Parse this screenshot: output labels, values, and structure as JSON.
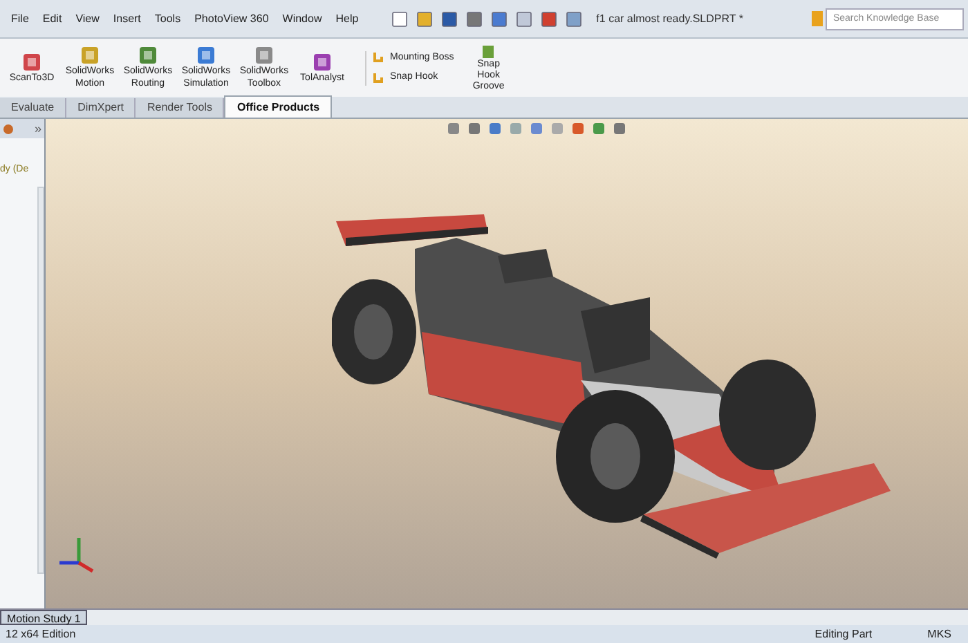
{
  "menu": [
    "File",
    "Edit",
    "View",
    "Insert",
    "Tools",
    "PhotoView 360",
    "Window",
    "Help"
  ],
  "document_title": "f1 car almost ready.SLDPRT *",
  "search": {
    "placeholder": "Search Knowledge Base"
  },
  "ribbon_tools": [
    {
      "label": "ScanTo3D",
      "kind": "scan"
    },
    {
      "label": "SolidWorks Motion",
      "kind": "motion"
    },
    {
      "label": "SolidWorks Routing",
      "kind": "routing"
    },
    {
      "label": "SolidWorks Simulation",
      "kind": "simulation"
    },
    {
      "label": "SolidWorks Toolbox",
      "kind": "toolbox"
    },
    {
      "label": "TolAnalyst",
      "kind": "tol"
    }
  ],
  "feature_tools": [
    "Mounting Boss",
    "Snap Hook"
  ],
  "large_feature_tool": "Snap Hook Groove",
  "tabs": [
    {
      "label": "Evaluate",
      "selected": false
    },
    {
      "label": "DimXpert",
      "selected": false
    },
    {
      "label": "Render Tools",
      "selected": false
    },
    {
      "label": "Office Products",
      "selected": true
    }
  ],
  "side_panel": {
    "expand": "»",
    "tree_item": "dy (De"
  },
  "bottom_tabs": [
    {
      "label": "Motion Study 1",
      "selected": true
    }
  ],
  "status_bar": {
    "edition": "12 x64 Edition",
    "mode": "Editing Part",
    "units": "MKS"
  }
}
